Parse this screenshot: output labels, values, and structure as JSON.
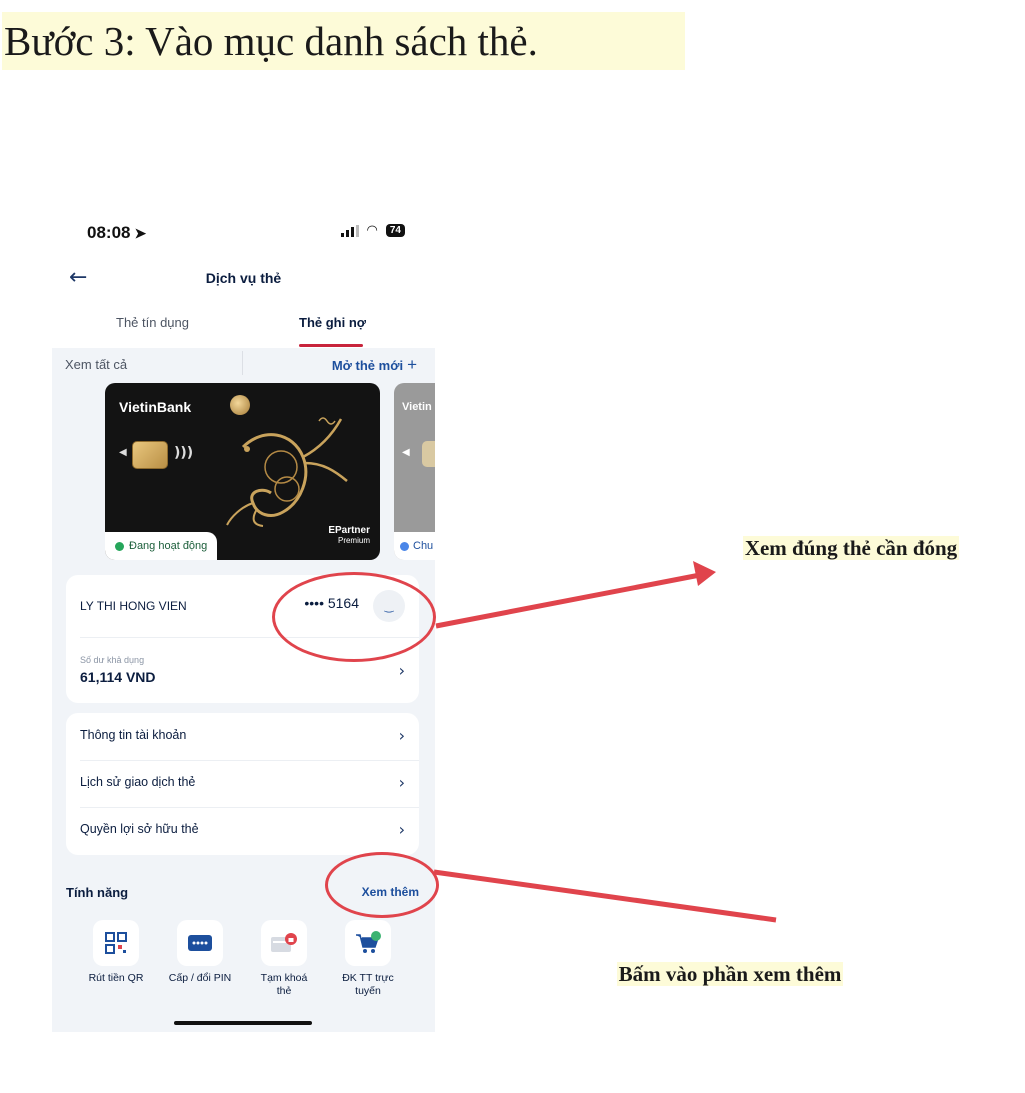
{
  "heading": "Bước 3: Vào mục danh sách thẻ.",
  "status": {
    "time": "08:08",
    "battery": "74"
  },
  "header": {
    "title": "Dịch vụ thẻ"
  },
  "tabs": [
    {
      "label": "Thẻ tín dụng"
    },
    {
      "label": "Thẻ ghi nợ"
    }
  ],
  "toolbar": {
    "see_all": "Xem tất cả",
    "open_new": "Mở thẻ mới"
  },
  "card": {
    "brand": "VietinBank",
    "partner": "EPartner",
    "tier": "Premium",
    "status": "Đang hoạt động"
  },
  "card2": {
    "brand": "Vietin",
    "status": "Chu"
  },
  "account": {
    "owner": "LY THI HONG VIEN",
    "masked_number": "•••• 5164",
    "balance_label": "Số dư khả dụng",
    "balance": "61,114 VND"
  },
  "menu": [
    {
      "label": "Thông tin tài khoản"
    },
    {
      "label": "Lịch sử giao dịch thẻ"
    },
    {
      "label": "Quyền lợi sở hữu thẻ"
    }
  ],
  "features": {
    "title": "Tính năng",
    "see_more": "Xem thêm",
    "items": [
      {
        "label": "Rút tiền QR"
      },
      {
        "label": "Cấp / đổi PIN"
      },
      {
        "label": "Tạm khoá thẻ"
      },
      {
        "label": "ĐK TT trực tuyến"
      }
    ]
  },
  "annotations": {
    "note1": "Xem đúng thẻ cần đóng",
    "note2": "Bấm vào phần xem thêm"
  },
  "colors": {
    "accent": "#c8243c",
    "link": "#1d4f9d",
    "annotation": "#e0444c",
    "highlight": "#fdfbd8"
  }
}
